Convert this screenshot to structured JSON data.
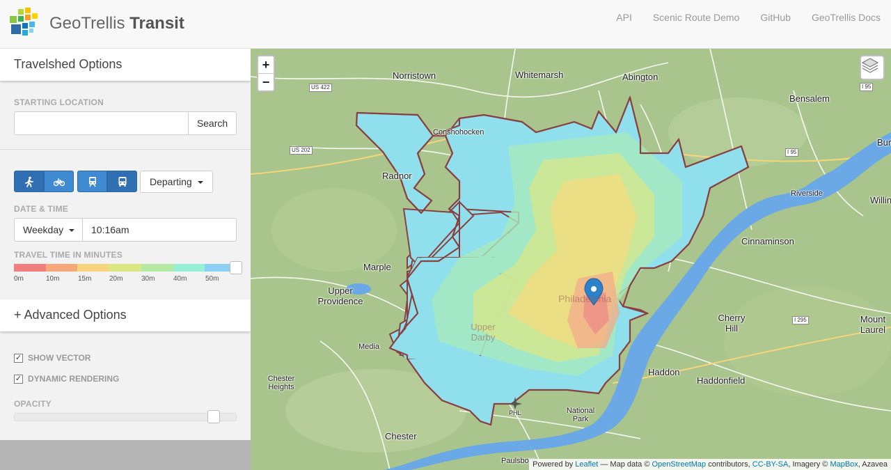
{
  "header": {
    "brand_light": "GeoTrellis",
    "brand_bold": "Transit",
    "nav": [
      "API",
      "Scenic Route Demo",
      "GitHub",
      "GeoTrellis Docs"
    ]
  },
  "sidebar": {
    "panel_title": "Travelshed Options",
    "starting_location_label": "STARTING LOCATION",
    "search_value": "",
    "search_button": "Search",
    "modes": {
      "walk_icon": "walking-icon",
      "bike_icon": "bicycle-icon",
      "train_icon": "train-icon",
      "bus_icon": "bus-icon"
    },
    "direction": "Departing",
    "date_time_label": "DATE & TIME",
    "day": "Weekday",
    "time": "10:16am",
    "travel_time_label": "TRAVEL TIME IN MINUTES",
    "travel_time_ticks": [
      "0m",
      "10m",
      "15m",
      "20m",
      "30m",
      "40m",
      "50m"
    ],
    "travel_time_colors": [
      "#f08080",
      "#f5a97a",
      "#f7d57e",
      "#d9e884",
      "#b6eaa3",
      "#95f0d6",
      "#8dd0f5"
    ],
    "travel_time_value": 1.0,
    "advanced_title": "+ Advanced Options",
    "show_vector": {
      "label": "SHOW VECTOR",
      "checked": true
    },
    "dynamic_rendering": {
      "label": "DYNAMIC RENDERING",
      "checked": true
    },
    "opacity_label": "OPACITY",
    "opacity_value": 0.9
  },
  "map": {
    "zoom_in": "+",
    "zoom_out": "−",
    "layers_icon": "layers-icon",
    "marker_icon": "map-marker-icon",
    "places": [
      "Norristown",
      "Whitemarsh",
      "Abington",
      "Bensalem",
      "Radnor",
      "Riverside",
      "Willin",
      "Cinnaminson",
      "Marple",
      "Upper Providence",
      "Cherry Hill",
      "Mount Laurel",
      "Media",
      "Haddon",
      "Haddonfield",
      "Chester Heights",
      "National Park",
      "Chester",
      "Paulsboro",
      "PHL",
      "Conshohocken",
      "Philadelphia",
      "Upper Darby",
      "Burl"
    ],
    "shields": [
      "US 422",
      "US 202",
      "I 95",
      "I 295"
    ],
    "attribution": {
      "prefix": "Powered by ",
      "leaflet": "Leaflet",
      "mapdata": " — Map data © ",
      "osm": "OpenStreetMap",
      "contributors": " contributors, ",
      "license": "CC-BY-SA",
      "imagery": ", Imagery © ",
      "mapbox": "MapBox",
      "azavea": ", Azavea"
    }
  }
}
